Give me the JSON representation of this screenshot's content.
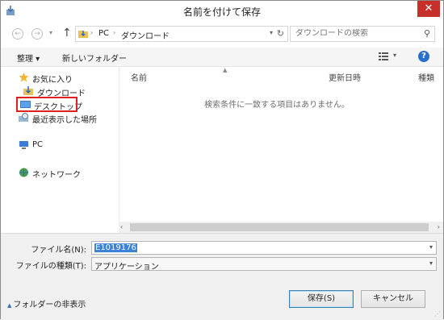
{
  "window": {
    "title": "名前を付けて保存",
    "close_glyph": "✕"
  },
  "nav": {
    "back_glyph": "←",
    "forward_glyph": "→",
    "history_glyph": "▾",
    "up_glyph": "↑",
    "breadcrumb": [
      "PC",
      "ダウンロード"
    ],
    "crumb_sep": "›",
    "search_placeholder": "ダウンロードの検索"
  },
  "toolbar": {
    "organize_label": "整理 ▾",
    "new_folder_label": "新しいフォルダー"
  },
  "sidebar": {
    "items": [
      {
        "label": "お気に入り",
        "icon": "star-icon"
      },
      {
        "label": "ダウンロード",
        "icon": "download-folder-icon"
      },
      {
        "label": "デスクトップ",
        "icon": "desktop-icon",
        "highlighted": true
      },
      {
        "label": "最近表示した場所",
        "icon": "recent-places-icon"
      },
      {
        "label": "PC",
        "icon": "computer-icon"
      },
      {
        "label": "ネットワーク",
        "icon": "network-icon"
      }
    ]
  },
  "columns": [
    "名前",
    "更新日時",
    "種類"
  ],
  "empty_message": "検索条件に一致する項目はありません。",
  "form": {
    "filename_label": "ファイル名(N):",
    "filename_value": "E1019176",
    "filetype_label": "ファイルの種類(T):",
    "filetype_value": "アプリケーション"
  },
  "footer": {
    "hide_folders_label": "フォルダーの非表示",
    "save_label": "保存(S)",
    "cancel_label": "キャンセル"
  },
  "colors": {
    "highlight": "#e0201e",
    "selection": "#3b82d8",
    "close": "#c7302a"
  }
}
